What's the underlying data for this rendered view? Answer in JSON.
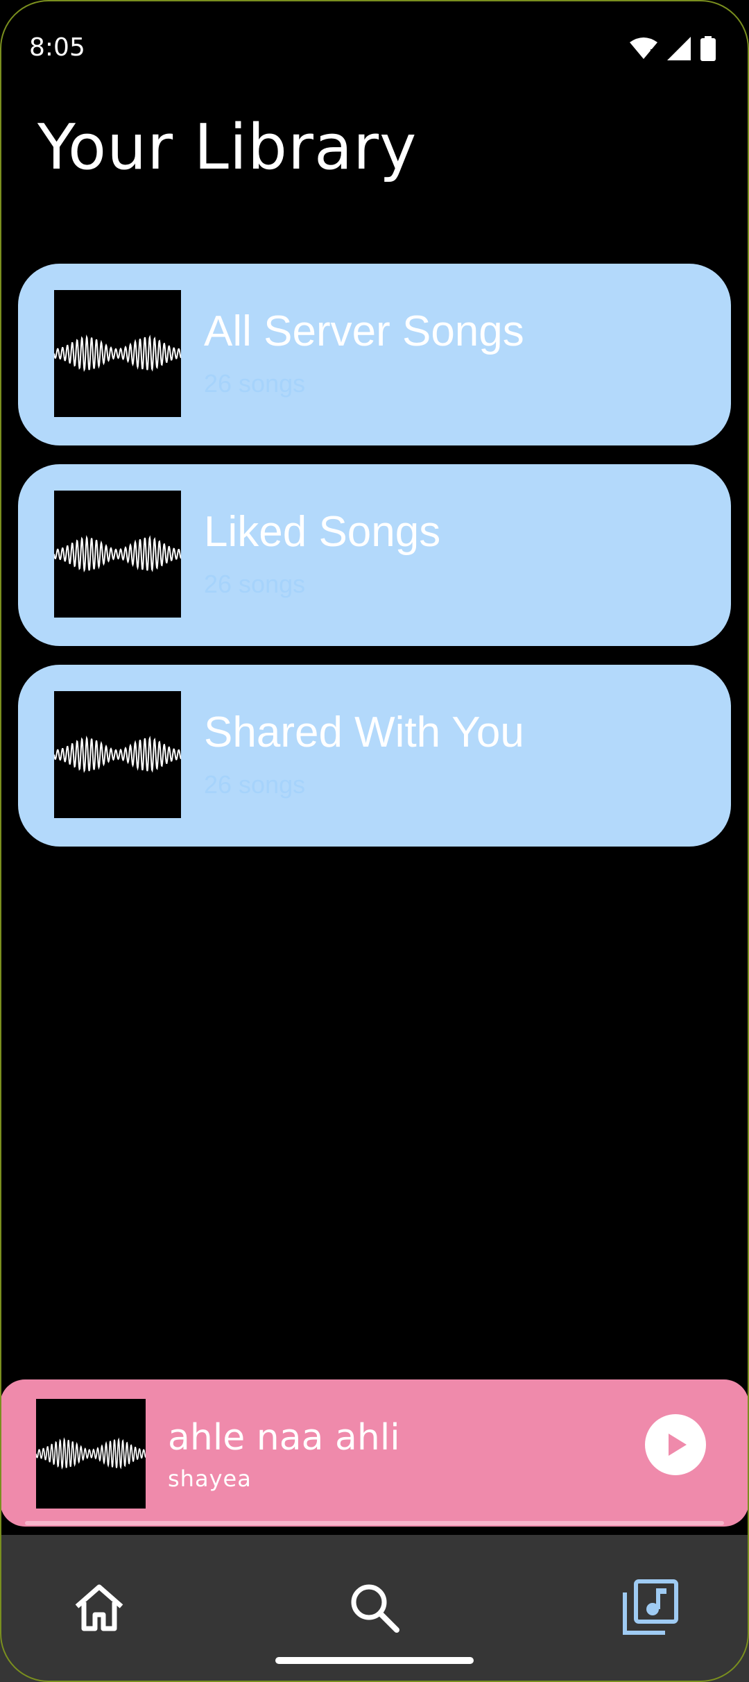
{
  "status_bar": {
    "time": "8:05"
  },
  "page": {
    "title": "Your Library"
  },
  "library_items": [
    {
      "title": "All Server Songs",
      "subtitle": "26 songs"
    },
    {
      "title": "Liked Songs",
      "subtitle": "26 songs"
    },
    {
      "title": "Shared With You",
      "subtitle": "26 songs"
    }
  ],
  "now_playing": {
    "title": "ahle naa ahli",
    "artist": "shayea",
    "progress": 0
  },
  "bottom_nav": {
    "items": [
      "home-icon",
      "search-icon",
      "library-music-icon"
    ],
    "active": "library-music-icon"
  },
  "colors": {
    "card_bg": "#b3d9fb",
    "mini_player_bg": "#ef8aab",
    "nav_bg": "#363636",
    "active_nav": "#9fcbf3"
  }
}
